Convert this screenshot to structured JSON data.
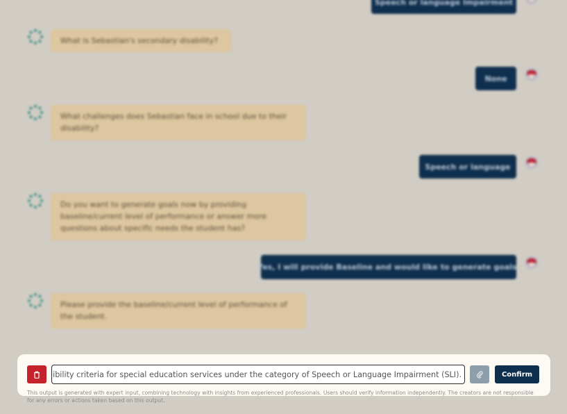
{
  "chat": {
    "messages": [
      {
        "role": "user",
        "text": "Speech or language Impairment"
      },
      {
        "role": "bot",
        "text": "What is Sebastian's secondary disability?"
      },
      {
        "role": "user",
        "text": "None"
      },
      {
        "role": "bot",
        "text": "What challenges does Sebastian face in school due to their disability?"
      },
      {
        "role": "user",
        "text": "Speech or language"
      },
      {
        "role": "bot",
        "text": "Do you want to generate goals now by providing baseline/current level of performance or answer more questions about specific needs the student has?"
      },
      {
        "role": "user",
        "text": "Yes, I will provide Baseline and would like to generate goals."
      },
      {
        "role": "bot",
        "text": "Please provide the baseline/current level of performance of the student."
      }
    ]
  },
  "composer": {
    "input_value": "Sebastian meets the eligibility criteria for special education services under the category of Speech or Language Impairment (SLI).",
    "confirm_label": "Confirm",
    "delete_icon": "trash-icon",
    "attach_icon": "paperclip-icon",
    "disclaimer": "This output is generated with expert input, combining technology with insights from experienced professionals. Users should verify information independently. The creators are not responsible for any errors or actions taken based on this output."
  },
  "colors": {
    "background": "#d1cdc4",
    "bot_bubble": "#ddc6a0",
    "user_bubble": "#0f2f4e",
    "delete_button": "#c4232b",
    "confirm_button": "#0f2f4e"
  }
}
